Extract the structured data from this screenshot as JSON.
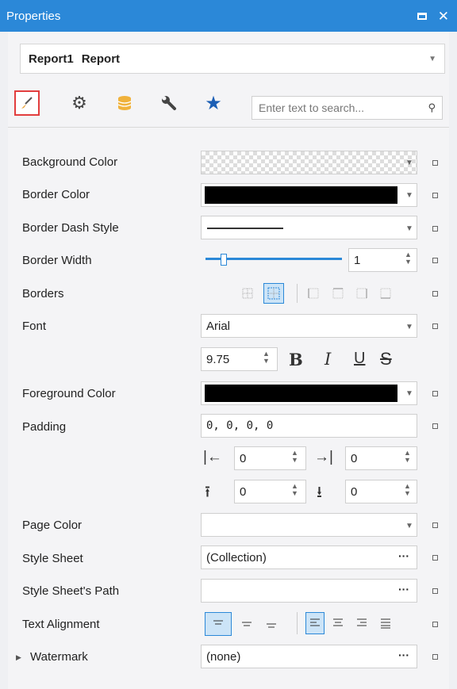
{
  "window": {
    "title": "Properties"
  },
  "selector": {
    "name": "Report1",
    "type": "Report"
  },
  "search": {
    "placeholder": "Enter text to search..."
  },
  "tabs": [
    {
      "name": "appearance",
      "icon": "paintbrush-icon"
    },
    {
      "name": "behavior",
      "icon": "gear-icon"
    },
    {
      "name": "data",
      "icon": "database-icon"
    },
    {
      "name": "tools",
      "icon": "wrench-icon"
    },
    {
      "name": "favorites",
      "icon": "star-icon"
    }
  ],
  "properties": {
    "background_color": {
      "label": "Background Color"
    },
    "border_color": {
      "label": "Border Color",
      "value": "#000000"
    },
    "border_dash_style": {
      "label": "Border Dash Style"
    },
    "border_width": {
      "label": "Border Width",
      "value": "1"
    },
    "borders": {
      "label": "Borders"
    },
    "font": {
      "label": "Font",
      "family": "Arial",
      "size": "9.75",
      "bold": "B",
      "italic": "I",
      "underline": "U",
      "strike": "S"
    },
    "foreground_color": {
      "label": "Foreground Color",
      "value": "#000000"
    },
    "padding": {
      "label": "Padding",
      "value": "0, 0, 0, 0",
      "left": "0",
      "right": "0",
      "top": "0",
      "bottom": "0"
    },
    "page_color": {
      "label": "Page Color"
    },
    "style_sheet": {
      "label": "Style Sheet",
      "value": "(Collection)"
    },
    "style_sheet_path": {
      "label": "Style Sheet's Path",
      "value": ""
    },
    "text_alignment": {
      "label": "Text Alignment"
    },
    "watermark": {
      "label": "Watermark",
      "value": "(none)"
    }
  },
  "ellipsis": "···",
  "colors": {
    "accent": "#2b88d8",
    "active_tab_border": "#e23e3e"
  }
}
